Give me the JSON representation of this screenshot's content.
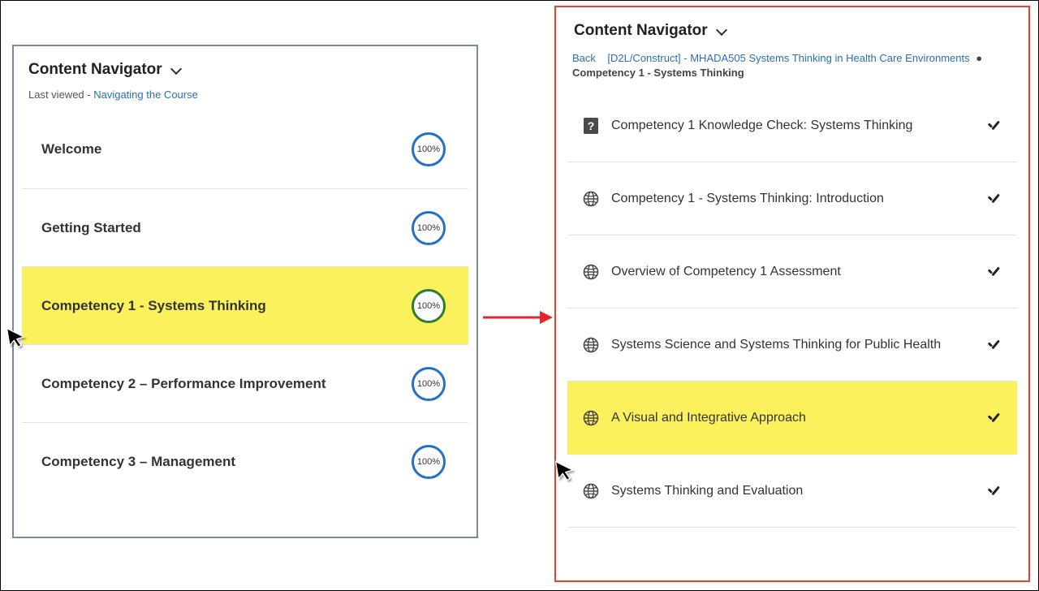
{
  "left": {
    "title": "Content Navigator",
    "last_viewed_prefix": "Last viewed - ",
    "last_viewed_link": "Navigating the Course",
    "modules": [
      {
        "label": "Welcome",
        "percent": "100%",
        "selected": false,
        "ring": "blue"
      },
      {
        "label": "Getting Started",
        "percent": "100%",
        "selected": false,
        "ring": "blue"
      },
      {
        "label": "Competency 1 - Systems Thinking",
        "percent": "100%",
        "selected": true,
        "ring": "green"
      },
      {
        "label": "Competency 2 – Performance Improvement",
        "percent": "100%",
        "selected": false,
        "ring": "blue"
      },
      {
        "label": "Competency 3 – Management",
        "percent": "100%",
        "selected": false,
        "ring": "blue"
      }
    ]
  },
  "right": {
    "title": "Content Navigator",
    "crumb_back": "Back",
    "crumb_course": "[D2L/Construct] - MHADA505 Systems Thinking in Health Care Environments",
    "crumb_current": "Competency 1 - Systems Thinking",
    "items": [
      {
        "icon": "quiz",
        "label": "Competency 1 Knowledge Check: Systems Thinking",
        "selected": false
      },
      {
        "icon": "web",
        "label": "Competency 1 - Systems Thinking: Introduction",
        "selected": false
      },
      {
        "icon": "web",
        "label": "Overview of Competency 1 Assessment",
        "selected": false
      },
      {
        "icon": "web",
        "label": "Systems Science and Systems Thinking for Public Health",
        "selected": false
      },
      {
        "icon": "web",
        "label": "A Visual and Integrative Approach",
        "selected": true
      },
      {
        "icon": "web",
        "label": "Systems Thinking and Evaluation",
        "selected": false
      }
    ]
  }
}
